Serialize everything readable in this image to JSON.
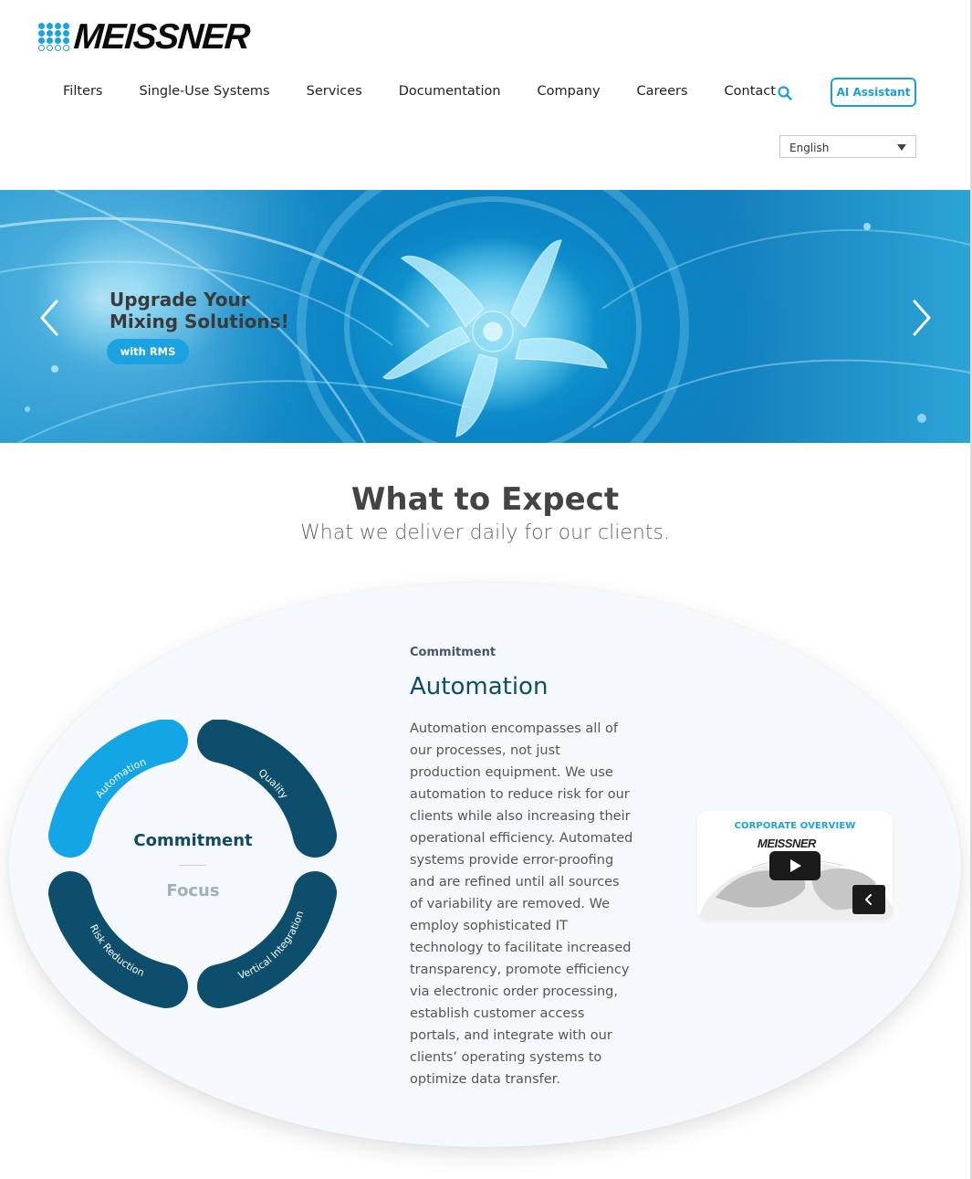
{
  "header": {
    "logo_text": "MEISSNER",
    "nav": [
      "Filters",
      "Single-Use Systems",
      "Services",
      "Documentation",
      "Company",
      "Careers",
      "Contact"
    ],
    "search_icon": "search-icon",
    "ai_button": "AI Assistant",
    "language": "English"
  },
  "hero": {
    "title_line1": "Upgrade Your",
    "title_line2": "Mixing Solutions!",
    "button": "with RMS"
  },
  "section": {
    "title": "What to Expect",
    "subtitle": "What we deliver daily for our clients."
  },
  "wheel": {
    "segments": [
      "Automation",
      "Quality",
      "Risk Reduction",
      "Vertical Integration"
    ],
    "center_active": "Commitment",
    "center_inactive": "Focus"
  },
  "detail": {
    "category": "Commitment",
    "heading": "Automation",
    "body": "Automation encompasses all of our processes, not just production equipment. We use automation to reduce risk for our clients while also increasing their operational efficiency. Automated systems provide error-proofing and are refined until all sources of variability are removed. We employ sophisticated IT technology to facilitate increased transparency, promote efficiency via electronic order processing, establish customer access portals, and integrate with our clients’ operating systems to optimize data transfer."
  },
  "video": {
    "label": "CORPORATE OVERVIEW",
    "logo": "MEISSNER"
  },
  "colors": {
    "accent": "#19a0db",
    "dark_blue": "#0d4e6d",
    "segment_active": "#13a5e6",
    "segment_dark": "#0d4e6d"
  }
}
